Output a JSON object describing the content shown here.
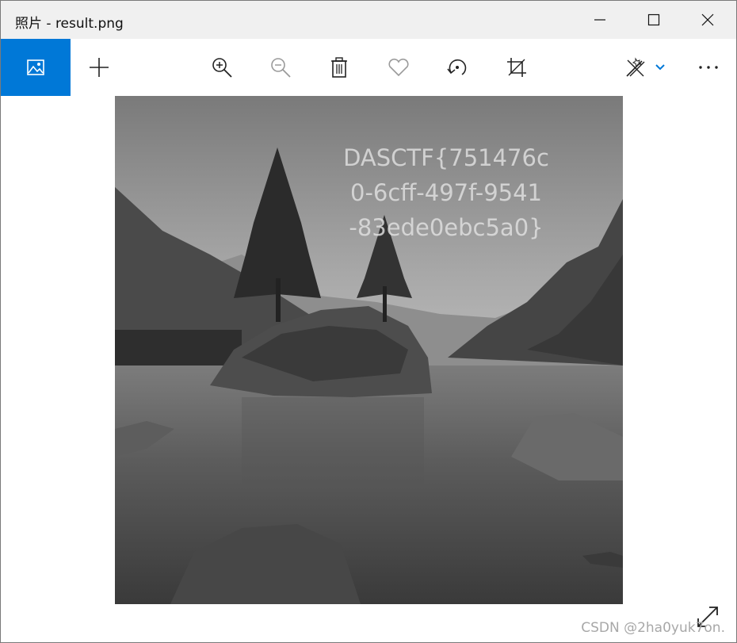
{
  "window": {
    "title": "照片 - result.png"
  },
  "toolbar": {
    "photo_icon": "image-icon",
    "add_icon": "plus-icon",
    "zoom_in_icon": "zoom-in-icon",
    "zoom_out_icon": "zoom-out-icon",
    "delete_icon": "trash-icon",
    "favorite_icon": "heart-icon",
    "rotate_icon": "rotate-icon",
    "crop_icon": "crop-icon",
    "edit_icon": "edit-draw-icon",
    "more_icon": "more-icon",
    "accent": "#0078d7"
  },
  "image": {
    "filename": "result.png",
    "overlay_lines": [
      "DASCTF{751476c",
      "0-6cff-497f-9541",
      "-83ede0ebc5a0}"
    ]
  },
  "watermark": "CSDN @2ha0yuk7on."
}
